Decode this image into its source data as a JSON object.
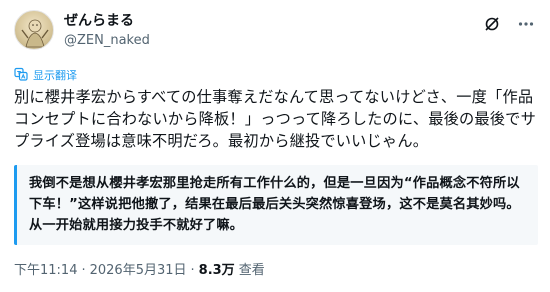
{
  "author": {
    "display_name": "ぜんらまる",
    "handle": "@ZEN_naked"
  },
  "header_icons": [
    "grok-icon",
    "more-icon"
  ],
  "translate_label": "显示翻译",
  "tweet": {
    "text": "別に櫻井孝宏からすべての仕事奪えだなんて思ってないけどさ、一度「作品コンセプトに合わないから降板！」っつって降ろしたのに、最後の最後でサプライズ登場は意味不明だろ。最初から継投でいいじゃん。"
  },
  "translation": {
    "text": "我倒不是想从櫻井孝宏那里抢走所有工作什么的，但是一旦因为“作品概念不符所以下车！”这样说把他撤了，结果在最后最后关头突然惊喜登场，这不是莫名其妙吗。从一开始就用接力投手不就好了嘛。"
  },
  "meta": {
    "time": "下午11:14",
    "sep1": "·",
    "date": "2026年5月31日",
    "sep2": "·",
    "views": "8.3万",
    "views_label": "查看"
  }
}
